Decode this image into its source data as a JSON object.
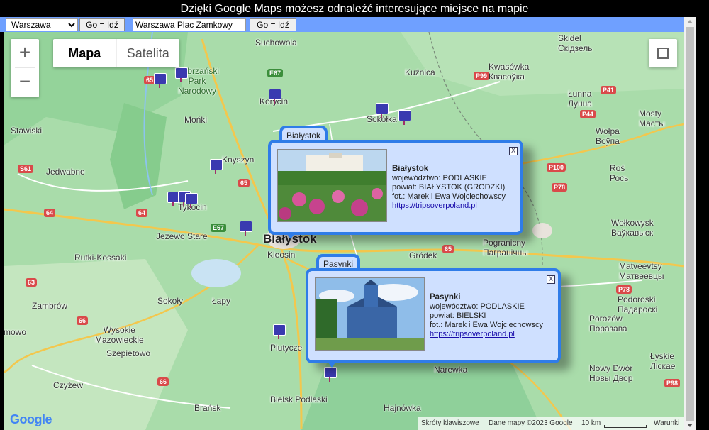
{
  "page_title": "Dzięki Google Maps możesz odnaleźć interesujące miejsce na mapie",
  "toolbar": {
    "city_select_value": "Warszawa",
    "go_label_1": "Go = Idź",
    "address_value": "Warszawa Plac Zamkowy",
    "go_label_2": "Go = Idź"
  },
  "map_controls": {
    "zoom_in": "+",
    "zoom_out": "−",
    "map_type_map": "Mapa",
    "map_type_satellite": "Satelita"
  },
  "places": {
    "suchowola": "Suchowola",
    "kuznica": "Kuźnica",
    "skidel": "Skidel\nСкідзель",
    "kwasowka": "Kwasówka\nКвасоўка",
    "biebrzanski": "Biebrzański\nPark\nNarodowy",
    "korycin": "Korycin",
    "lunna": "Łunna\nЛунна",
    "monki": "Mońki",
    "sokolka": "Sokółka",
    "mosty": "Mosty\nМасты",
    "stawiski": "Stawiski",
    "wolpa": "Wołpa\nВоўпа",
    "knyszyn": "Knyszyn",
    "jedwabne": "Jedwabne",
    "ros": "Roś\nРось",
    "tykocin": "Tykocin",
    "jezewo": "Jeżewo Stare",
    "bialystok": "Białystok",
    "rutki": "Rutki-Kossaki",
    "kleosin": "Kleosin",
    "grodek": "Gródek",
    "pogranicny": "Pogranicny\nПагранічны",
    "matveevtsy": "Matveevtsy\nМатвеевцы",
    "wolkowysk": "Wołkowysk\nВаўкавыск",
    "zambrow": "Zambrów",
    "sokoly": "Sokoły",
    "lapy": "Łapy",
    "podoroski": "Podoroski\nПадароскі",
    "wysokie": "Wysokie\nMazowieckie",
    "porozow": "Porozów\nПоразава",
    "szepietowo": "Szepietowo",
    "plutycze": "Plutycze",
    "czyzew": "Czyżew",
    "narewka": "Narewka",
    "nowy_dwor": "Nowy Dwór\nНовы Двор",
    "lyskie": "Łyskie\nЛіскае",
    "bransk": "Brańsk",
    "bielsk": "Bielsk Podlaski",
    "hajnowka": "Hajnówka",
    "mowo": "mowo"
  },
  "popups": [
    {
      "tab": "Białystok",
      "name": "Białystok",
      "voivodeship": "województwo: PODLASKIE",
      "county": "powiat: BIAŁYSTOK (GRODZKI)",
      "photo_credit": "fot.: Marek i Ewa Wojciechowscy",
      "link": "https://tripsoverpoland.pl",
      "close": "X"
    },
    {
      "tab": "Pasynki",
      "name": "Pasynki",
      "voivodeship": "województwo: PODLASKIE",
      "county": "powiat: BIELSKI",
      "photo_credit": "fot.: Marek i Ewa Wojciechowscy",
      "link": "https://tripsoverpoland.pl",
      "close": "X"
    }
  ],
  "footer": {
    "shortcuts": "Skróty klawiszowe",
    "map_data": "Dane mapy ©2023 Google",
    "scale": "10 km",
    "terms": "Warunki"
  },
  "logo": "Google",
  "colors": {
    "accent": "#2f7ce8",
    "toolbar": "#6fa0ff",
    "popup_bg": "#cfe0ff"
  }
}
